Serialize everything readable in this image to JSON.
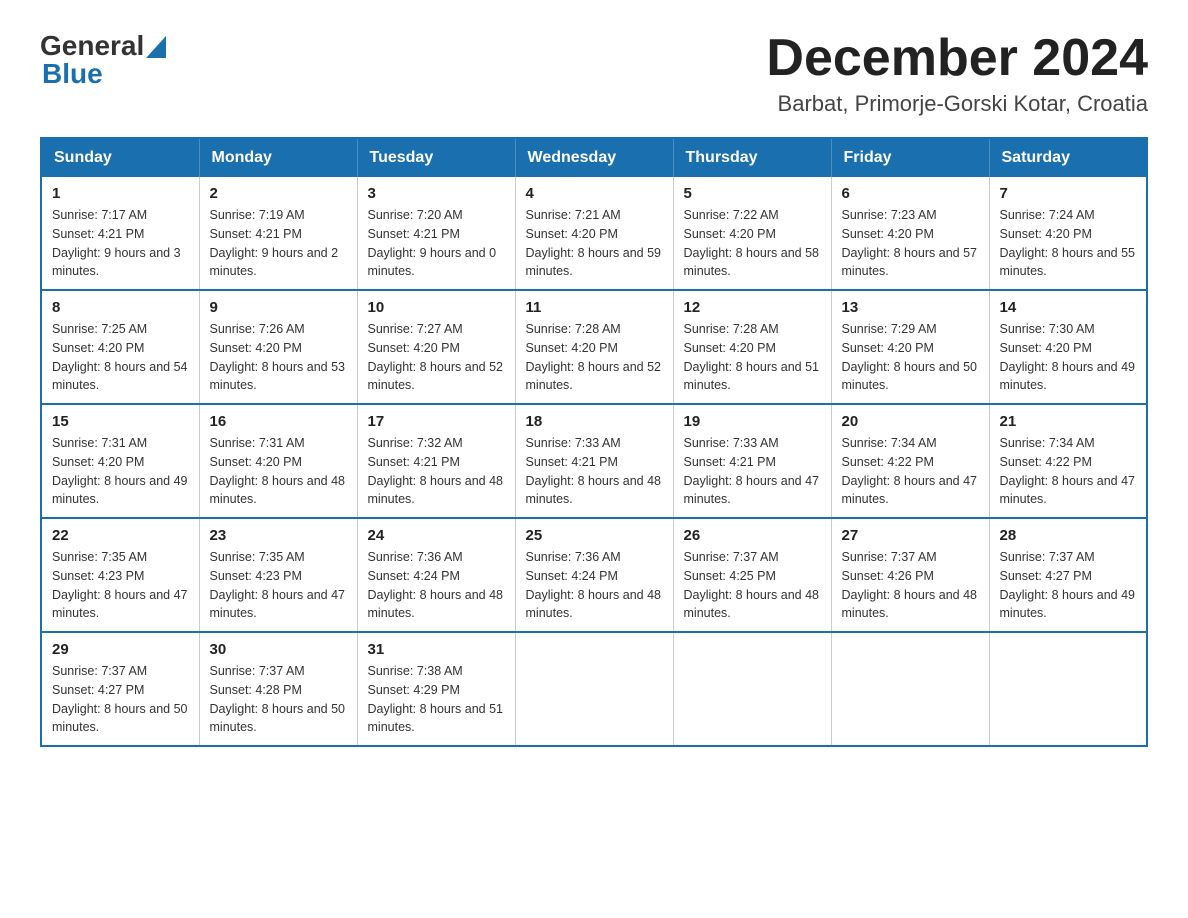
{
  "header": {
    "logo_general": "General",
    "logo_blue": "Blue",
    "title": "December 2024",
    "subtitle": "Barbat, Primorje-Gorski Kotar, Croatia"
  },
  "days_of_week": [
    "Sunday",
    "Monday",
    "Tuesday",
    "Wednesday",
    "Thursday",
    "Friday",
    "Saturday"
  ],
  "weeks": [
    [
      {
        "day": "1",
        "sunrise": "7:17 AM",
        "sunset": "4:21 PM",
        "daylight": "9 hours and 3 minutes."
      },
      {
        "day": "2",
        "sunrise": "7:19 AM",
        "sunset": "4:21 PM",
        "daylight": "9 hours and 2 minutes."
      },
      {
        "day": "3",
        "sunrise": "7:20 AM",
        "sunset": "4:21 PM",
        "daylight": "9 hours and 0 minutes."
      },
      {
        "day": "4",
        "sunrise": "7:21 AM",
        "sunset": "4:20 PM",
        "daylight": "8 hours and 59 minutes."
      },
      {
        "day": "5",
        "sunrise": "7:22 AM",
        "sunset": "4:20 PM",
        "daylight": "8 hours and 58 minutes."
      },
      {
        "day": "6",
        "sunrise": "7:23 AM",
        "sunset": "4:20 PM",
        "daylight": "8 hours and 57 minutes."
      },
      {
        "day": "7",
        "sunrise": "7:24 AM",
        "sunset": "4:20 PM",
        "daylight": "8 hours and 55 minutes."
      }
    ],
    [
      {
        "day": "8",
        "sunrise": "7:25 AM",
        "sunset": "4:20 PM",
        "daylight": "8 hours and 54 minutes."
      },
      {
        "day": "9",
        "sunrise": "7:26 AM",
        "sunset": "4:20 PM",
        "daylight": "8 hours and 53 minutes."
      },
      {
        "day": "10",
        "sunrise": "7:27 AM",
        "sunset": "4:20 PM",
        "daylight": "8 hours and 52 minutes."
      },
      {
        "day": "11",
        "sunrise": "7:28 AM",
        "sunset": "4:20 PM",
        "daylight": "8 hours and 52 minutes."
      },
      {
        "day": "12",
        "sunrise": "7:28 AM",
        "sunset": "4:20 PM",
        "daylight": "8 hours and 51 minutes."
      },
      {
        "day": "13",
        "sunrise": "7:29 AM",
        "sunset": "4:20 PM",
        "daylight": "8 hours and 50 minutes."
      },
      {
        "day": "14",
        "sunrise": "7:30 AM",
        "sunset": "4:20 PM",
        "daylight": "8 hours and 49 minutes."
      }
    ],
    [
      {
        "day": "15",
        "sunrise": "7:31 AM",
        "sunset": "4:20 PM",
        "daylight": "8 hours and 49 minutes."
      },
      {
        "day": "16",
        "sunrise": "7:31 AM",
        "sunset": "4:20 PM",
        "daylight": "8 hours and 48 minutes."
      },
      {
        "day": "17",
        "sunrise": "7:32 AM",
        "sunset": "4:21 PM",
        "daylight": "8 hours and 48 minutes."
      },
      {
        "day": "18",
        "sunrise": "7:33 AM",
        "sunset": "4:21 PM",
        "daylight": "8 hours and 48 minutes."
      },
      {
        "day": "19",
        "sunrise": "7:33 AM",
        "sunset": "4:21 PM",
        "daylight": "8 hours and 47 minutes."
      },
      {
        "day": "20",
        "sunrise": "7:34 AM",
        "sunset": "4:22 PM",
        "daylight": "8 hours and 47 minutes."
      },
      {
        "day": "21",
        "sunrise": "7:34 AM",
        "sunset": "4:22 PM",
        "daylight": "8 hours and 47 minutes."
      }
    ],
    [
      {
        "day": "22",
        "sunrise": "7:35 AM",
        "sunset": "4:23 PM",
        "daylight": "8 hours and 47 minutes."
      },
      {
        "day": "23",
        "sunrise": "7:35 AM",
        "sunset": "4:23 PM",
        "daylight": "8 hours and 47 minutes."
      },
      {
        "day": "24",
        "sunrise": "7:36 AM",
        "sunset": "4:24 PM",
        "daylight": "8 hours and 48 minutes."
      },
      {
        "day": "25",
        "sunrise": "7:36 AM",
        "sunset": "4:24 PM",
        "daylight": "8 hours and 48 minutes."
      },
      {
        "day": "26",
        "sunrise": "7:37 AM",
        "sunset": "4:25 PM",
        "daylight": "8 hours and 48 minutes."
      },
      {
        "day": "27",
        "sunrise": "7:37 AM",
        "sunset": "4:26 PM",
        "daylight": "8 hours and 48 minutes."
      },
      {
        "day": "28",
        "sunrise": "7:37 AM",
        "sunset": "4:27 PM",
        "daylight": "8 hours and 49 minutes."
      }
    ],
    [
      {
        "day": "29",
        "sunrise": "7:37 AM",
        "sunset": "4:27 PM",
        "daylight": "8 hours and 50 minutes."
      },
      {
        "day": "30",
        "sunrise": "7:37 AM",
        "sunset": "4:28 PM",
        "daylight": "8 hours and 50 minutes."
      },
      {
        "day": "31",
        "sunrise": "7:38 AM",
        "sunset": "4:29 PM",
        "daylight": "8 hours and 51 minutes."
      },
      null,
      null,
      null,
      null
    ]
  ]
}
